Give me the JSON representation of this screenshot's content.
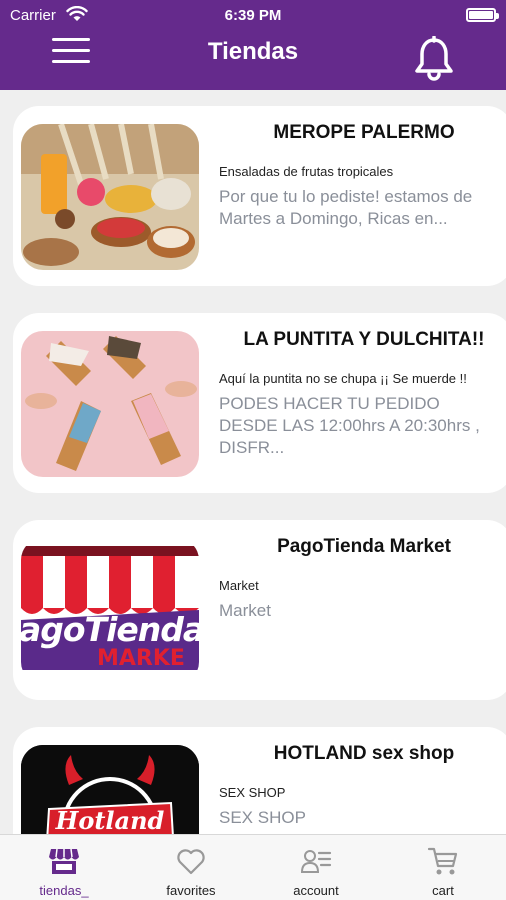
{
  "status_bar": {
    "carrier": "Carrier",
    "time": "6:39 PM"
  },
  "header": {
    "title": "Tiendas",
    "menu_icon": "hamburger-menu-icon",
    "notification_icon": "bell-icon",
    "background": "#652a8c"
  },
  "stores": [
    {
      "name": "MEROPE PALERMO",
      "category": "Ensaladas de frutas tropicales",
      "description": "Por que tu lo pediste! estamos de Martes a Domingo, Ricas en..."
    },
    {
      "name": "LA PUNTITA Y DULCHITA!!",
      "category": "Aquí la puntita no se chupa ¡¡ Se muerde !!",
      "description": "PODES HACER TU PEDIDO DESDE LAS 12:00hrs A 20:30hrs , DISFR..."
    },
    {
      "name": "PagoTienda Market",
      "category": "Market",
      "description": "Market",
      "logo_text": "agoTienda",
      "logo_subtext": "MARKE"
    },
    {
      "name": "HOTLAND sex shop",
      "category": "SEX SHOP",
      "description": "SEX SHOP",
      "logo_text": "Hotland"
    }
  ],
  "tabbar": {
    "tabs": [
      {
        "label": "tiendas_",
        "icon": "store-icon",
        "active": true
      },
      {
        "label": "favorites",
        "icon": "heart-icon"
      },
      {
        "label": "account",
        "icon": "account-list-icon"
      },
      {
        "label": "cart",
        "icon": "cart-icon"
      }
    ]
  }
}
